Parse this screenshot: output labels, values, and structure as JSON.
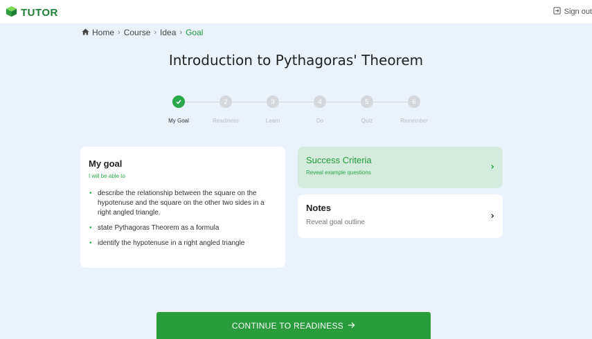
{
  "header": {
    "logo_text": "TUTOR",
    "logo_icon": "cube-icon",
    "signout_label": "Sign out",
    "signout_icon": "sign-out-icon"
  },
  "breadcrumb": {
    "home_icon": "home-icon",
    "items": [
      "Home",
      "Course",
      "Idea",
      "Goal"
    ]
  },
  "page_title": "Introduction to Pythagoras' Theorem",
  "stepper": {
    "steps": [
      {
        "number": "1",
        "label": "My Goal",
        "state": "done"
      },
      {
        "number": "2",
        "label": "Readiness",
        "state": "pending"
      },
      {
        "number": "3",
        "label": "Learn",
        "state": "pending"
      },
      {
        "number": "4",
        "label": "Do",
        "state": "pending"
      },
      {
        "number": "5",
        "label": "Quiz",
        "state": "pending"
      },
      {
        "number": "6",
        "label": "Remember",
        "state": "pending"
      }
    ]
  },
  "goal": {
    "title": "My goal",
    "subtitle": "I will be able to",
    "items": [
      "describe the relationship between the square on the hypotenuse and the square on the other two sides in a right angled triangle.",
      "state Pythagoras Theorem as a formula",
      "identify the hypotenuse in a right angled triangle"
    ]
  },
  "success_criteria": {
    "title": "Success Criteria",
    "subtitle": "Reveal example questions"
  },
  "notes": {
    "title": "Notes",
    "subtitle": "Reveal goal outline"
  },
  "continue_button": {
    "label": "CONTINUE TO READINESS",
    "icon": "arrow-right-icon"
  },
  "colors": {
    "brand_green": "#2a9c3c",
    "background": "#eaf3fb",
    "success_card": "#d5ebde"
  }
}
